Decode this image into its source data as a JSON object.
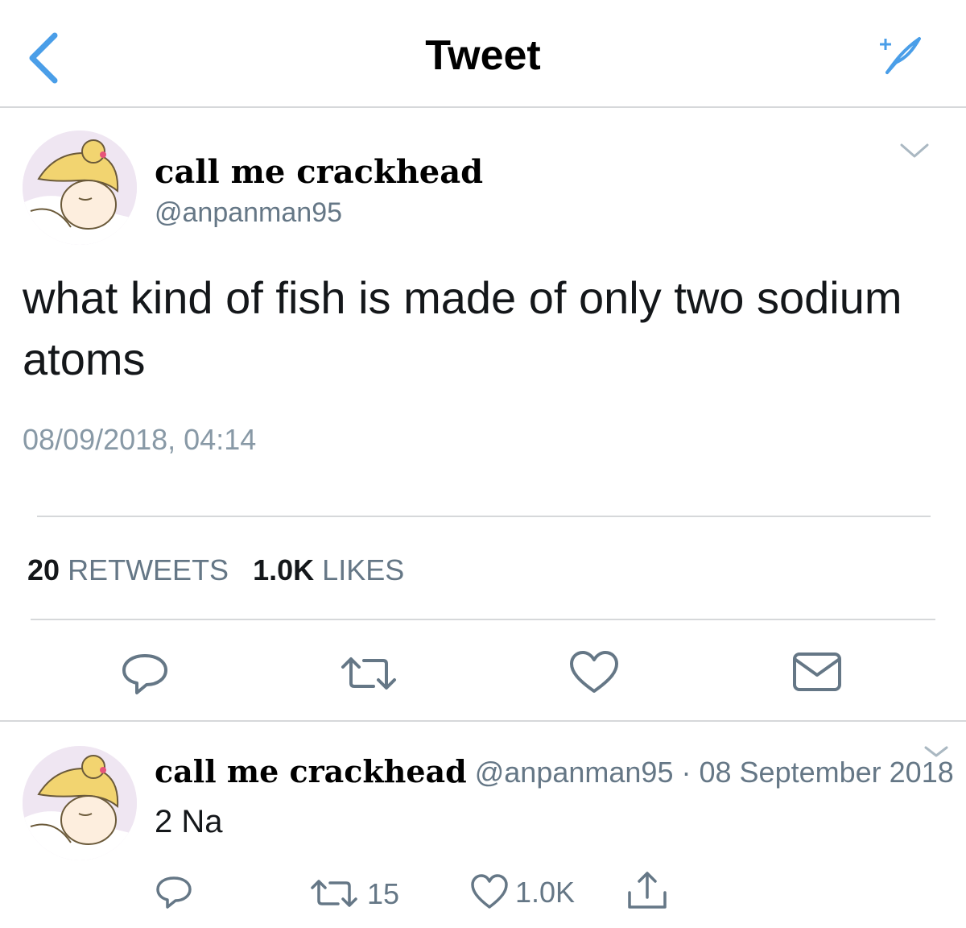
{
  "header": {
    "title": "Tweet",
    "back_icon": "chevron-left-icon",
    "compose_icon": "feather-sparkle-icon",
    "accent_color": "#4a9ee8"
  },
  "main_tweet": {
    "display_name": "call me crackhead",
    "handle": "@anpanman95",
    "text": "what kind of fish is made of only two sodium atoms",
    "timestamp": "08/09/2018, 04:14",
    "retweets_count": "20",
    "retweets_label": "RETWEETS",
    "likes_count": "1.0K",
    "likes_label": "LIKES",
    "actions": [
      "reply-icon",
      "retweet-icon",
      "like-icon",
      "direct-message-icon"
    ]
  },
  "reply_tweet": {
    "display_name": "call me crackhead",
    "handle": "@anpanman95",
    "separator": "·",
    "date": "08 September 2018",
    "text": "2 Na",
    "retweets_count": "15",
    "likes_count": "1.0K",
    "actions": [
      "reply-icon",
      "retweet-icon",
      "like-icon",
      "share-icon"
    ]
  },
  "colors": {
    "text": "#14171a",
    "secondary": "#657786",
    "timestamp": "#8899a6",
    "divider": "#d6d8da"
  }
}
